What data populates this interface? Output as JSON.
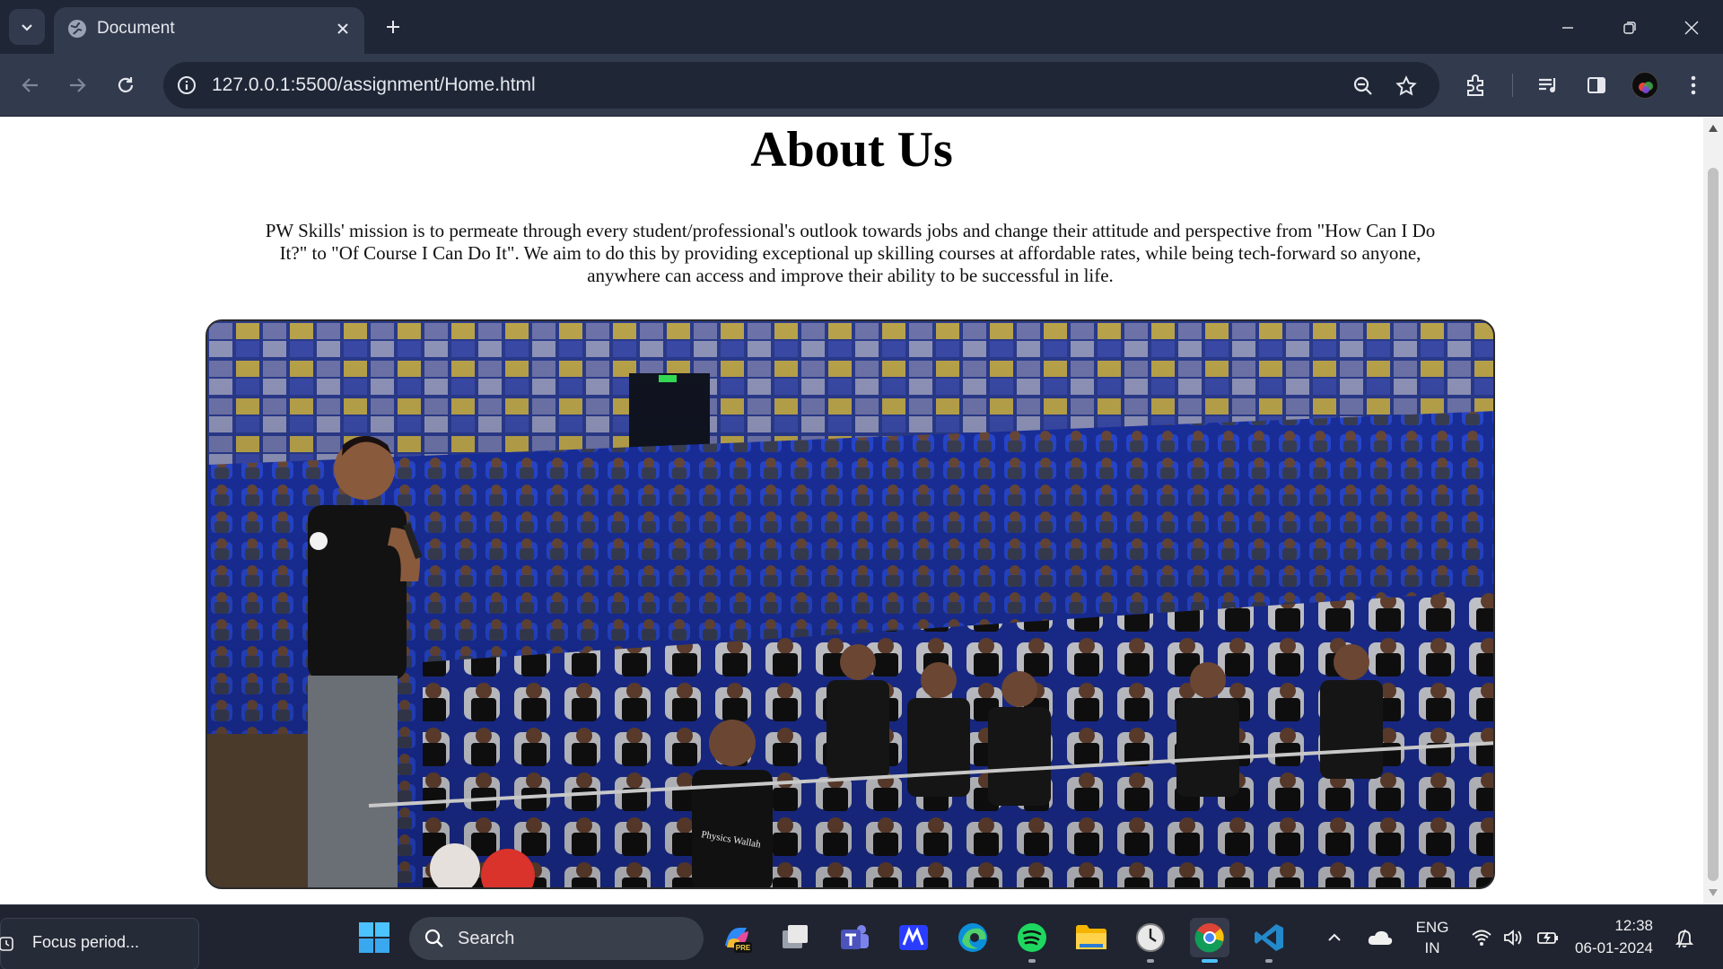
{
  "browser": {
    "tab_title": "Document",
    "url": "127.0.0.1:5500/assignment/Home.html"
  },
  "page": {
    "heading": "About Us",
    "paragraph": "PW Skills' mission is to permeate through every student/professional's outlook towards jobs and change their attitude and perspective from \"How Can I Do It?\" to \"Of Course I Can Do It\". We aim to do this by providing exceptional up skilling courses at affordable rates, while being tech-forward so anyone, anywhere can access and improve their ability to be successful in life.",
    "image_text": "Physics Wallah"
  },
  "taskbar": {
    "focus_label": "Focus period...",
    "search_label": "Search",
    "language": "ENG",
    "region": "IN",
    "time": "12:38",
    "date": "06-01-2024"
  },
  "colors": {
    "chrome_dark": "#1f2636",
    "chrome_toolbar": "#323a4d",
    "taskbar": "#1f2430",
    "accent": "#4cc2ff"
  }
}
